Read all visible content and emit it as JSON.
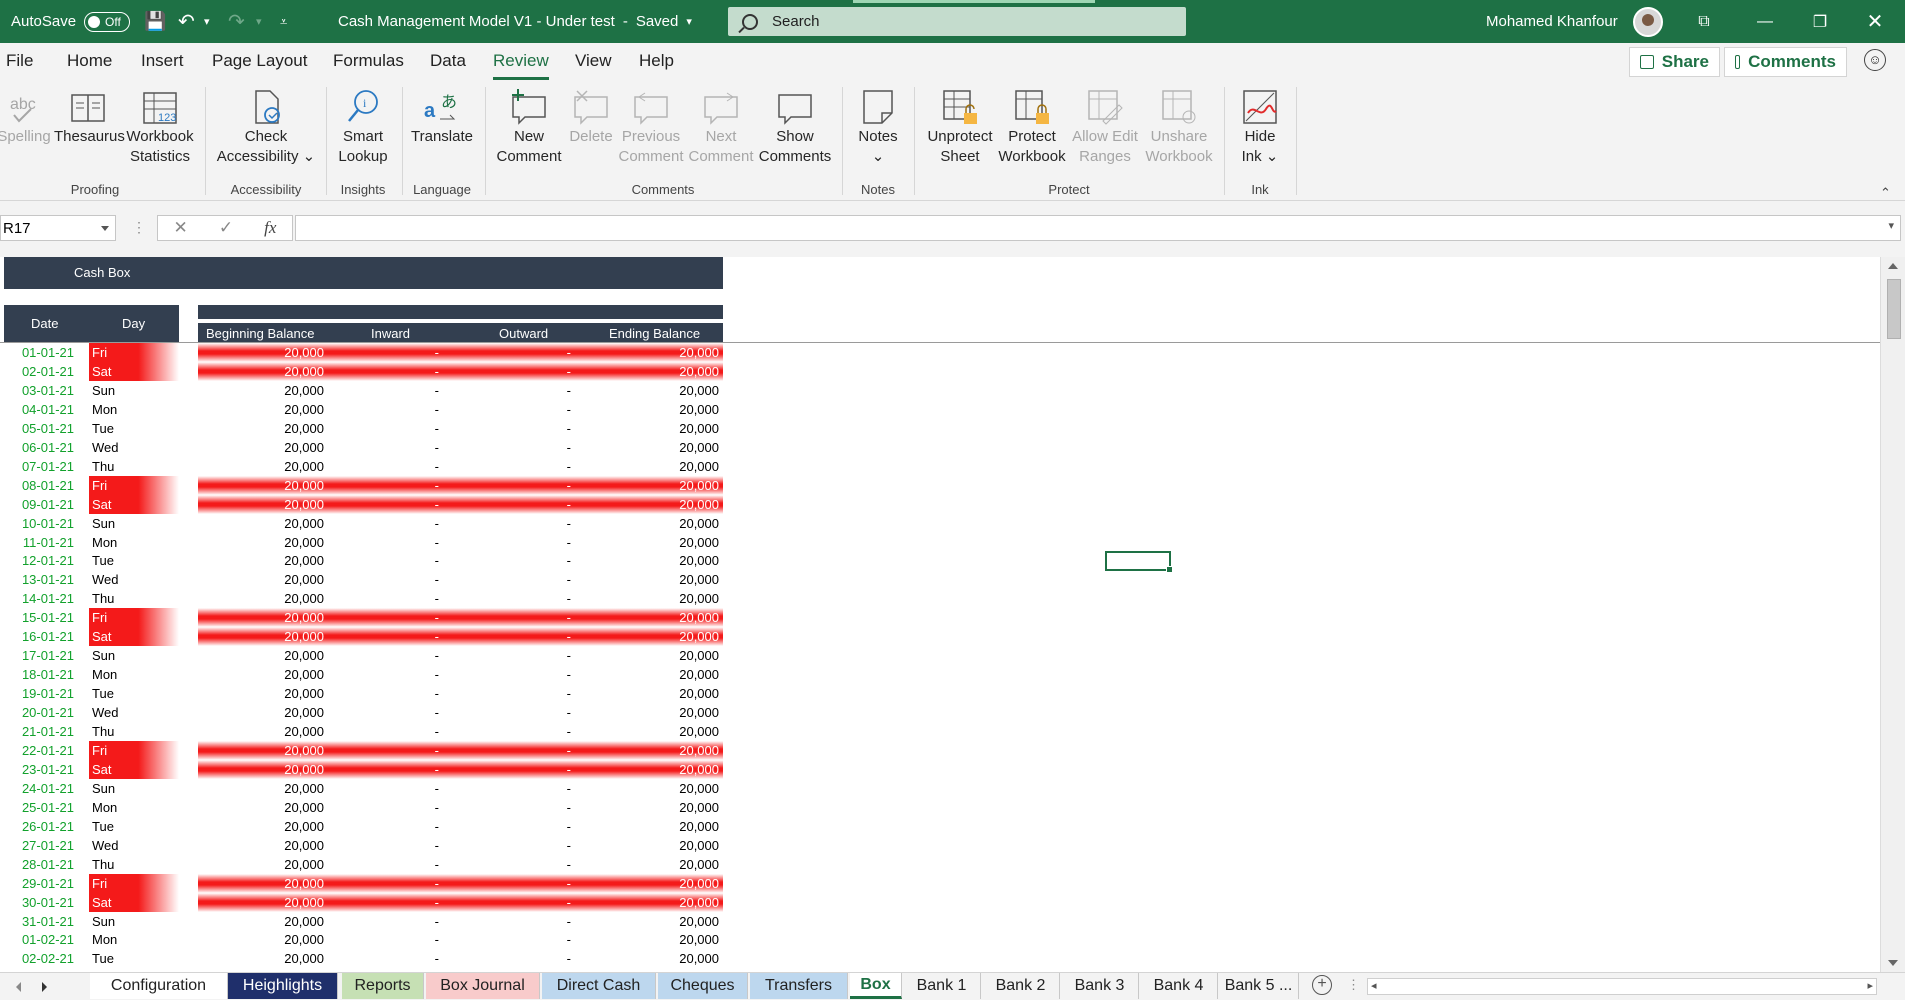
{
  "titlebar": {
    "autosave_label": "AutoSave",
    "autosave_state": "Off",
    "doc_title": "Cash Management Model V1 - Under test",
    "saved_status": "Saved",
    "search_placeholder": "Search",
    "user_name": "Mohamed Khanfour"
  },
  "menu": {
    "tabs": [
      "File",
      "Home",
      "Insert",
      "Page Layout",
      "Formulas",
      "Data",
      "Review",
      "View",
      "Help"
    ],
    "active": "Review",
    "share_label": "Share",
    "comments_label": "Comments"
  },
  "ribbon": {
    "buttons": [
      {
        "line1": "Spelling",
        "line2": "",
        "disabled": true
      },
      {
        "line1": "Thesaurus",
        "line2": ""
      },
      {
        "line1": "Workbook",
        "line2": "Statistics"
      },
      {
        "line1": "Check",
        "line2": "Accessibility ⌄"
      },
      {
        "line1": "Smart",
        "line2": "Lookup"
      },
      {
        "line1": "Translate",
        "line2": ""
      },
      {
        "line1": "New",
        "line2": "Comment"
      },
      {
        "line1": "Delete",
        "line2": "",
        "disabled": true
      },
      {
        "line1": "Previous",
        "line2": "Comment",
        "disabled": true
      },
      {
        "line1": "Next",
        "line2": "Comment",
        "disabled": true
      },
      {
        "line1": "Show",
        "line2": "Comments"
      },
      {
        "line1": "Notes",
        "line2": "⌄"
      },
      {
        "line1": "Unprotect",
        "line2": "Sheet"
      },
      {
        "line1": "Protect",
        "line2": "Workbook"
      },
      {
        "line1": "Allow Edit",
        "line2": "Ranges",
        "disabled": true
      },
      {
        "line1": "Unshare",
        "line2": "Workbook",
        "disabled": true
      },
      {
        "line1": "Hide",
        "line2": "Ink ⌄"
      }
    ],
    "groups": [
      "Proofing",
      "Accessibility",
      "Insights",
      "Language",
      "Comments",
      "Notes",
      "Protect",
      "Ink"
    ]
  },
  "formula_bar": {
    "name_box": "R17",
    "fx_label": "fx",
    "formula": ""
  },
  "sheet": {
    "title": "Cash Box",
    "col_date": "Date",
    "col_day": "Day",
    "col_beginning": "Beginning Balance",
    "col_inward": "Inward",
    "col_outward": "Outward",
    "col_ending": "Ending Balance",
    "rows": [
      {
        "date": "01-01-21",
        "day": "Fri",
        "beg": "20,000",
        "in": "-",
        "out": "-",
        "end": "20,000",
        "weekend": true
      },
      {
        "date": "02-01-21",
        "day": "Sat",
        "beg": "20,000",
        "in": "-",
        "out": "-",
        "end": "20,000",
        "weekend": true
      },
      {
        "date": "03-01-21",
        "day": "Sun",
        "beg": "20,000",
        "in": "-",
        "out": "-",
        "end": "20,000",
        "weekend": false
      },
      {
        "date": "04-01-21",
        "day": "Mon",
        "beg": "20,000",
        "in": "-",
        "out": "-",
        "end": "20,000",
        "weekend": false
      },
      {
        "date": "05-01-21",
        "day": "Tue",
        "beg": "20,000",
        "in": "-",
        "out": "-",
        "end": "20,000",
        "weekend": false
      },
      {
        "date": "06-01-21",
        "day": "Wed",
        "beg": "20,000",
        "in": "-",
        "out": "-",
        "end": "20,000",
        "weekend": false
      },
      {
        "date": "07-01-21",
        "day": "Thu",
        "beg": "20,000",
        "in": "-",
        "out": "-",
        "end": "20,000",
        "weekend": false
      },
      {
        "date": "08-01-21",
        "day": "Fri",
        "beg": "20,000",
        "in": "-",
        "out": "-",
        "end": "20,000",
        "weekend": true
      },
      {
        "date": "09-01-21",
        "day": "Sat",
        "beg": "20,000",
        "in": "-",
        "out": "-",
        "end": "20,000",
        "weekend": true
      },
      {
        "date": "10-01-21",
        "day": "Sun",
        "beg": "20,000",
        "in": "-",
        "out": "-",
        "end": "20,000",
        "weekend": false
      },
      {
        "date": "11-01-21",
        "day": "Mon",
        "beg": "20,000",
        "in": "-",
        "out": "-",
        "end": "20,000",
        "weekend": false
      },
      {
        "date": "12-01-21",
        "day": "Tue",
        "beg": "20,000",
        "in": "-",
        "out": "-",
        "end": "20,000",
        "weekend": false
      },
      {
        "date": "13-01-21",
        "day": "Wed",
        "beg": "20,000",
        "in": "-",
        "out": "-",
        "end": "20,000",
        "weekend": false
      },
      {
        "date": "14-01-21",
        "day": "Thu",
        "beg": "20,000",
        "in": "-",
        "out": "-",
        "end": "20,000",
        "weekend": false
      },
      {
        "date": "15-01-21",
        "day": "Fri",
        "beg": "20,000",
        "in": "-",
        "out": "-",
        "end": "20,000",
        "weekend": true
      },
      {
        "date": "16-01-21",
        "day": "Sat",
        "beg": "20,000",
        "in": "-",
        "out": "-",
        "end": "20,000",
        "weekend": true
      },
      {
        "date": "17-01-21",
        "day": "Sun",
        "beg": "20,000",
        "in": "-",
        "out": "-",
        "end": "20,000",
        "weekend": false
      },
      {
        "date": "18-01-21",
        "day": "Mon",
        "beg": "20,000",
        "in": "-",
        "out": "-",
        "end": "20,000",
        "weekend": false
      },
      {
        "date": "19-01-21",
        "day": "Tue",
        "beg": "20,000",
        "in": "-",
        "out": "-",
        "end": "20,000",
        "weekend": false
      },
      {
        "date": "20-01-21",
        "day": "Wed",
        "beg": "20,000",
        "in": "-",
        "out": "-",
        "end": "20,000",
        "weekend": false
      },
      {
        "date": "21-01-21",
        "day": "Thu",
        "beg": "20,000",
        "in": "-",
        "out": "-",
        "end": "20,000",
        "weekend": false
      },
      {
        "date": "22-01-21",
        "day": "Fri",
        "beg": "20,000",
        "in": "-",
        "out": "-",
        "end": "20,000",
        "weekend": true
      },
      {
        "date": "23-01-21",
        "day": "Sat",
        "beg": "20,000",
        "in": "-",
        "out": "-",
        "end": "20,000",
        "weekend": true
      },
      {
        "date": "24-01-21",
        "day": "Sun",
        "beg": "20,000",
        "in": "-",
        "out": "-",
        "end": "20,000",
        "weekend": false
      },
      {
        "date": "25-01-21",
        "day": "Mon",
        "beg": "20,000",
        "in": "-",
        "out": "-",
        "end": "20,000",
        "weekend": false
      },
      {
        "date": "26-01-21",
        "day": "Tue",
        "beg": "20,000",
        "in": "-",
        "out": "-",
        "end": "20,000",
        "weekend": false
      },
      {
        "date": "27-01-21",
        "day": "Wed",
        "beg": "20,000",
        "in": "-",
        "out": "-",
        "end": "20,000",
        "weekend": false
      },
      {
        "date": "28-01-21",
        "day": "Thu",
        "beg": "20,000",
        "in": "-",
        "out": "-",
        "end": "20,000",
        "weekend": false
      },
      {
        "date": "29-01-21",
        "day": "Fri",
        "beg": "20,000",
        "in": "-",
        "out": "-",
        "end": "20,000",
        "weekend": true
      },
      {
        "date": "30-01-21",
        "day": "Sat",
        "beg": "20,000",
        "in": "-",
        "out": "-",
        "end": "20,000",
        "weekend": true
      },
      {
        "date": "31-01-21",
        "day": "Sun",
        "beg": "20,000",
        "in": "-",
        "out": "-",
        "end": "20,000",
        "weekend": false
      },
      {
        "date": "01-02-21",
        "day": "Mon",
        "beg": "20,000",
        "in": "-",
        "out": "-",
        "end": "20,000",
        "weekend": false
      },
      {
        "date": "02-02-21",
        "day": "Tue",
        "beg": "20,000",
        "in": "-",
        "out": "-",
        "end": "20,000",
        "weekend": false
      }
    ]
  },
  "sheet_tabs": [
    {
      "label": "Configuration",
      "bg": "#ffffff",
      "fg": "#222222"
    },
    {
      "label": "Heighlights",
      "bg": "#1f2f6b",
      "fg": "#ffffff"
    },
    {
      "label": "Reports",
      "bg": "#c6e0b4",
      "fg": "#222222"
    },
    {
      "label": "Box Journal",
      "bg": "#f8cbcb",
      "fg": "#222222"
    },
    {
      "label": "Direct Cash",
      "bg": "#bdd7ee",
      "fg": "#222222"
    },
    {
      "label": "Cheques",
      "bg": "#bdd7ee",
      "fg": "#222222"
    },
    {
      "label": "Transfers",
      "bg": "#bdd7ee",
      "fg": "#222222"
    },
    {
      "label": "Box",
      "bg": "#ffffff",
      "fg": "#1e7145",
      "active": true
    },
    {
      "label": "Bank 1",
      "bg": "#f3f3f3",
      "fg": "#222222"
    },
    {
      "label": "Bank 2",
      "bg": "#f3f3f3",
      "fg": "#222222"
    },
    {
      "label": "Bank 3",
      "bg": "#f3f3f3",
      "fg": "#222222"
    },
    {
      "label": "Bank 4",
      "bg": "#f3f3f3",
      "fg": "#222222"
    },
    {
      "label": "Bank 5 ...",
      "bg": "#f3f3f3",
      "fg": "#222222"
    }
  ],
  "colors": {
    "accent": "#1e7145",
    "header_dark": "#333f50",
    "weekend_red": "#f41a1a",
    "date_green": "#12a12c"
  }
}
